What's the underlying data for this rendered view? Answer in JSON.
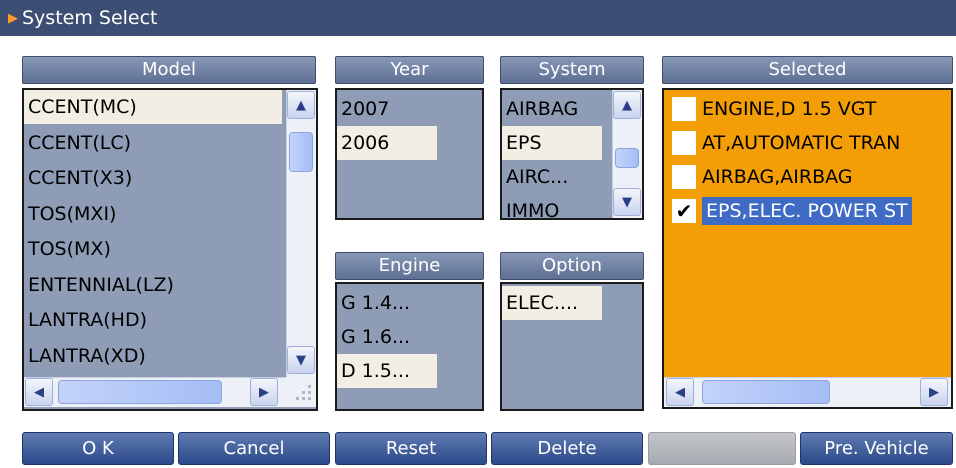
{
  "window": {
    "title": "System Select"
  },
  "headers": {
    "model": "Model",
    "year": "Year",
    "system": "System",
    "selected": "Selected",
    "engine": "Engine",
    "option": "Option"
  },
  "model_list": [
    "CCENT(MC)",
    "CCENT(LC)",
    "CCENT(X3)",
    "TOS(MXI)",
    "TOS(MX)",
    "ENTENNIAL(LZ)",
    "LANTRA(HD)",
    "LANTRA(XD)"
  ],
  "model_selected_index": 0,
  "year_list": [
    "2007",
    "2006"
  ],
  "year_selected_index": 1,
  "system_list": [
    "AIRBAG",
    "EPS",
    "AIRC...",
    "IMMO"
  ],
  "system_selected_index": 1,
  "engine_list": [
    "G 1.4...",
    "G 1.6...",
    "D 1.5..."
  ],
  "engine_selected_index": 2,
  "option_list": [
    "ELEC...."
  ],
  "option_selected_index": 0,
  "selected_list": [
    {
      "label": "ENGINE,D 1.5 VGT",
      "checked": false
    },
    {
      "label": "AT,AUTOMATIC TRAN",
      "checked": false
    },
    {
      "label": "AIRBAG,AIRBAG",
      "checked": false
    },
    {
      "label": "EPS,ELEC. POWER ST",
      "checked": true
    }
  ],
  "selected_highlight_index": 3,
  "buttons": {
    "ok": "O K",
    "cancel": "Cancel",
    "reset": "Reset",
    "delete": "Delete",
    "blank": "",
    "pre_vehicle": "Pre. Vehicle"
  },
  "icons": {
    "title_marker": "triangle-right-icon",
    "scroll_up": "chevron-up-icon",
    "scroll_down": "chevron-down-icon",
    "scroll_left": "chevron-left-icon",
    "scroll_right": "chevron-right-icon",
    "check": "checkmark-icon"
  },
  "colors": {
    "titlebar": "#3c4e74",
    "list_bg": "#8e9cb6",
    "selected_panel_bg": "#f39e06",
    "highlight": "#3f6bc4",
    "button": "#3d5a98"
  }
}
